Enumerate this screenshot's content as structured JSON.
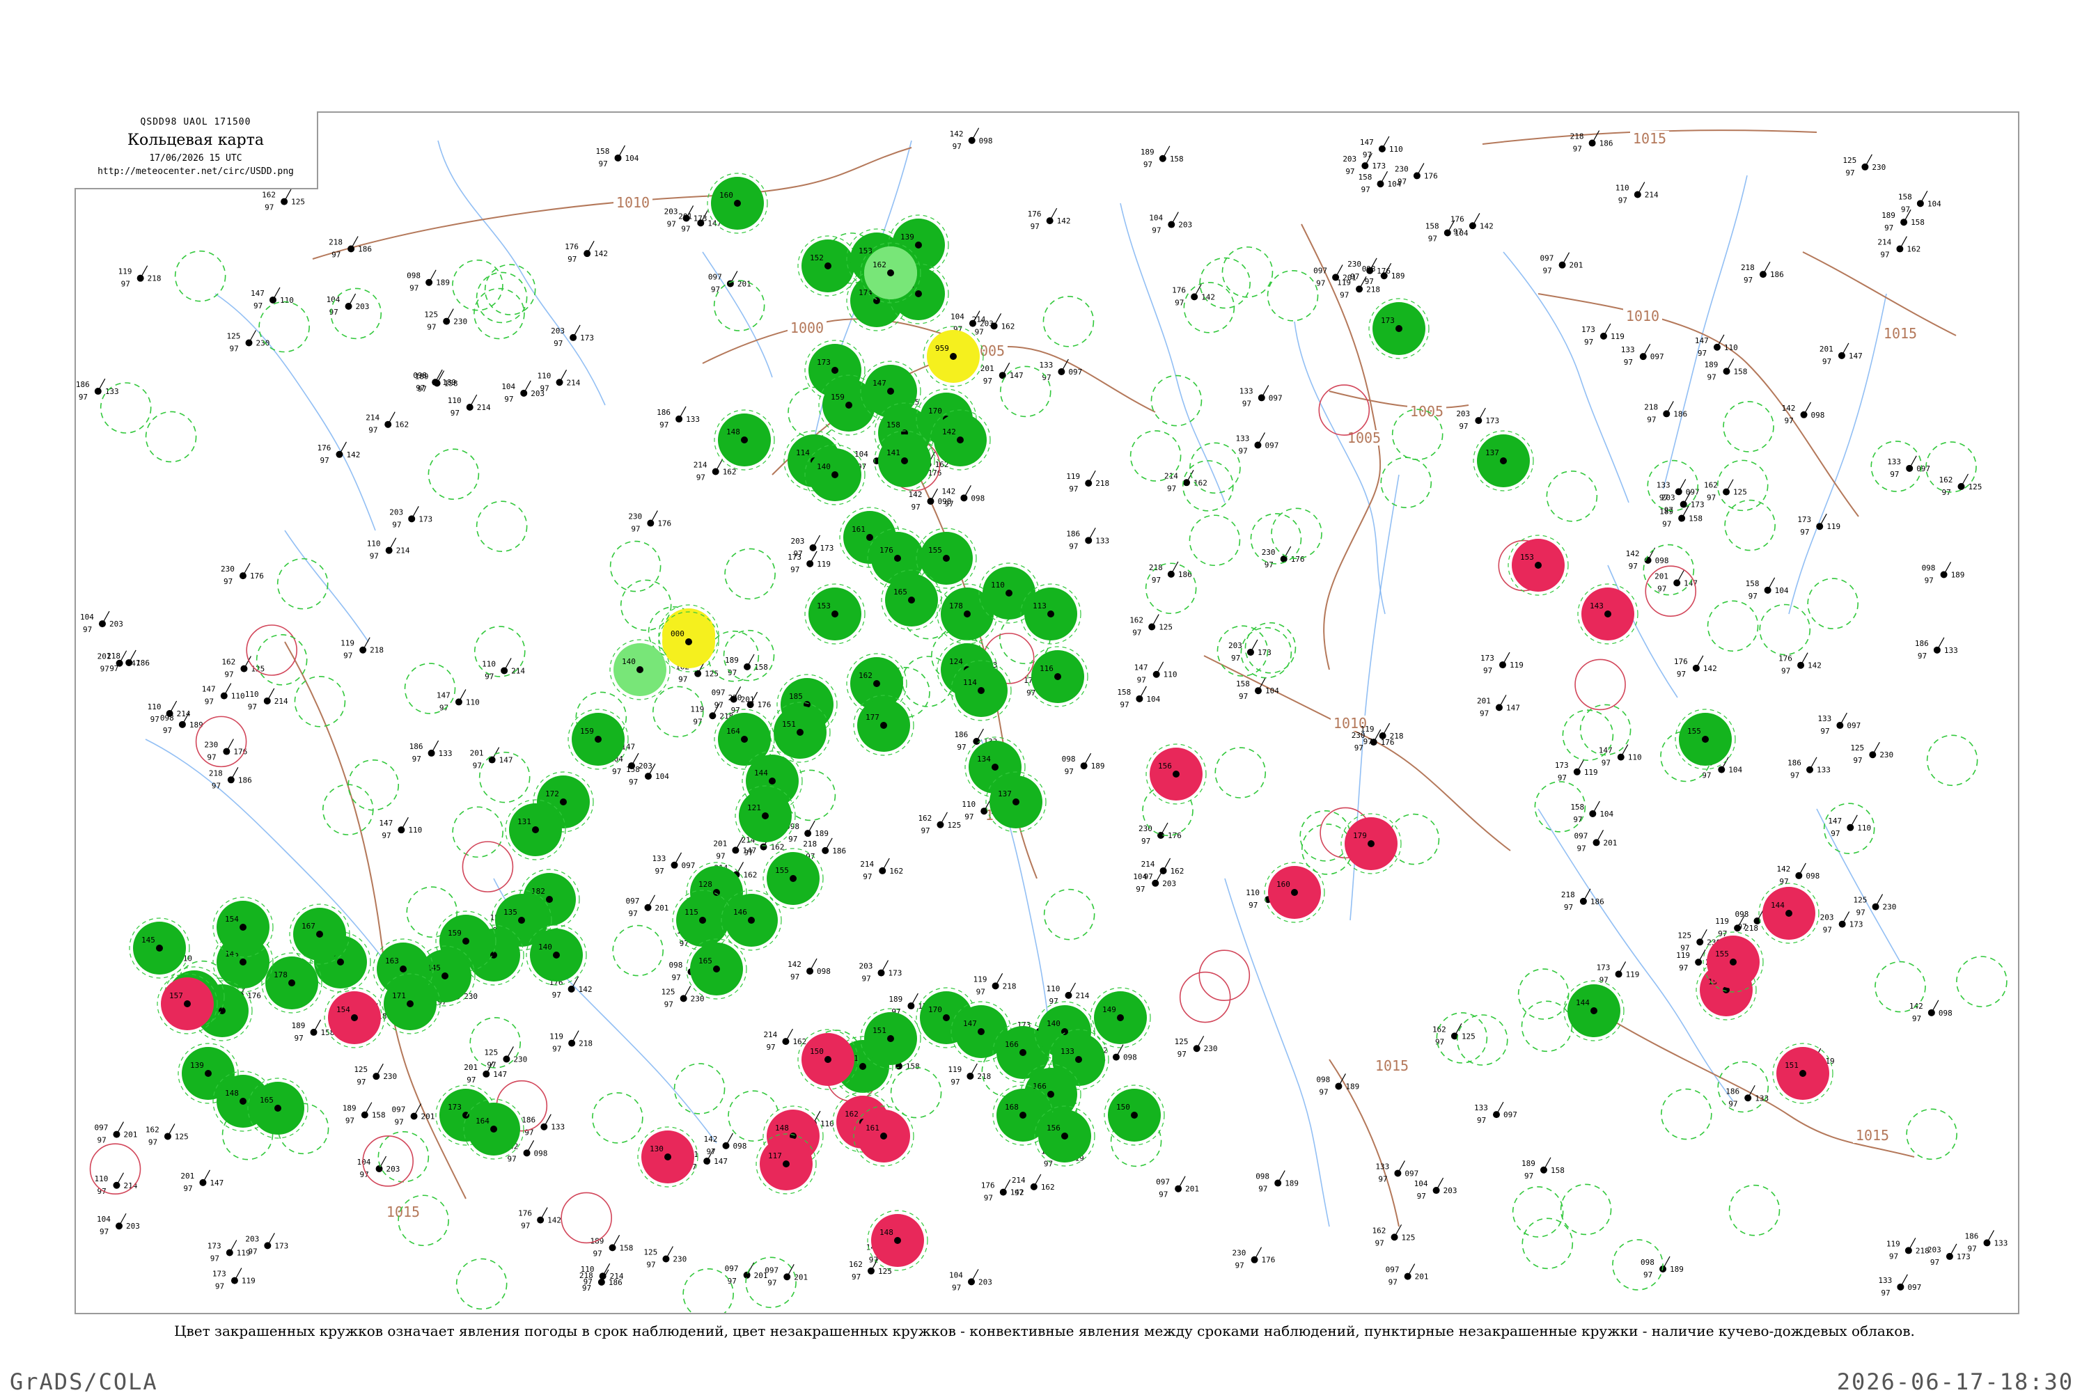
{
  "header": {
    "code": "QSDD98  UAOL  171500",
    "title": "Кольцевая карта",
    "datetime": "17/06/2026 15 UTC",
    "url": "http://meteocenter.net/circ/USDD.png"
  },
  "caption": "Цвет закрашенных кружков означает явления погоды в срок наблюдений, цвет незакрашенных кружков - конвективные явления между сроками наблюдений, пунктирные незакрашенные кружки - наличие кучево-дождевых облаков.",
  "footer": {
    "left": "GrADS/COLA",
    "right": "2026-06-17-18:30"
  },
  "colors": {
    "green": "#14b41e",
    "light_green": "#78e678",
    "red": "#e8285a",
    "yellow": "#f5f01e",
    "isobar": "#b4785a",
    "river": "#6eaaf0",
    "dashed_green": "#32c83c",
    "pink_ring": "#d2465a"
  },
  "isobars": [
    {
      "label": "1015"
    },
    {
      "label": "1010"
    },
    {
      "label": "1005"
    },
    {
      "label": "1000"
    },
    {
      "label": "1005"
    },
    {
      "label": "1010"
    },
    {
      "label": "1015"
    },
    {
      "label": "1010"
    },
    {
      "label": "1015"
    },
    {
      "label": "1015"
    },
    {
      "label": "1010"
    },
    {
      "label": "1005"
    },
    {
      "label": "1015"
    }
  ],
  "stations": {
    "green": [
      "160",
      "152",
      "153",
      "139",
      "174",
      "165",
      "173",
      "159",
      "147",
      "158",
      "170",
      "142",
      "141",
      "114",
      "140",
      "148",
      "161",
      "176",
      "155",
      "165",
      "178",
      "110",
      "124",
      "114",
      "113",
      "116",
      "134",
      "137",
      "153",
      "162",
      "177",
      "185",
      "151",
      "164",
      "144",
      "121",
      "128",
      "115",
      "146",
      "155",
      "165",
      "159",
      "172",
      "131",
      "182",
      "135",
      "140",
      "162",
      "159",
      "145",
      "163",
      "140",
      "167",
      "178",
      "143",
      "130",
      "183",
      "145",
      "154",
      "139",
      "148",
      "165",
      "171",
      "173",
      "164",
      "191",
      "151",
      "170",
      "147",
      "166",
      "140",
      "133",
      "166",
      "168",
      "156",
      "149",
      "150",
      "173",
      "137",
      "155",
      "144"
    ],
    "red": [
      "157",
      "154",
      "130",
      "156",
      "160",
      "179",
      "150",
      "162",
      "161",
      "148",
      "117",
      "148",
      "153",
      "143",
      "144",
      "150",
      "155",
      "151"
    ],
    "yellow": [
      "98",
      "959",
      "000"
    ],
    "light_green": [
      "140",
      "135",
      "162"
    ]
  }
}
